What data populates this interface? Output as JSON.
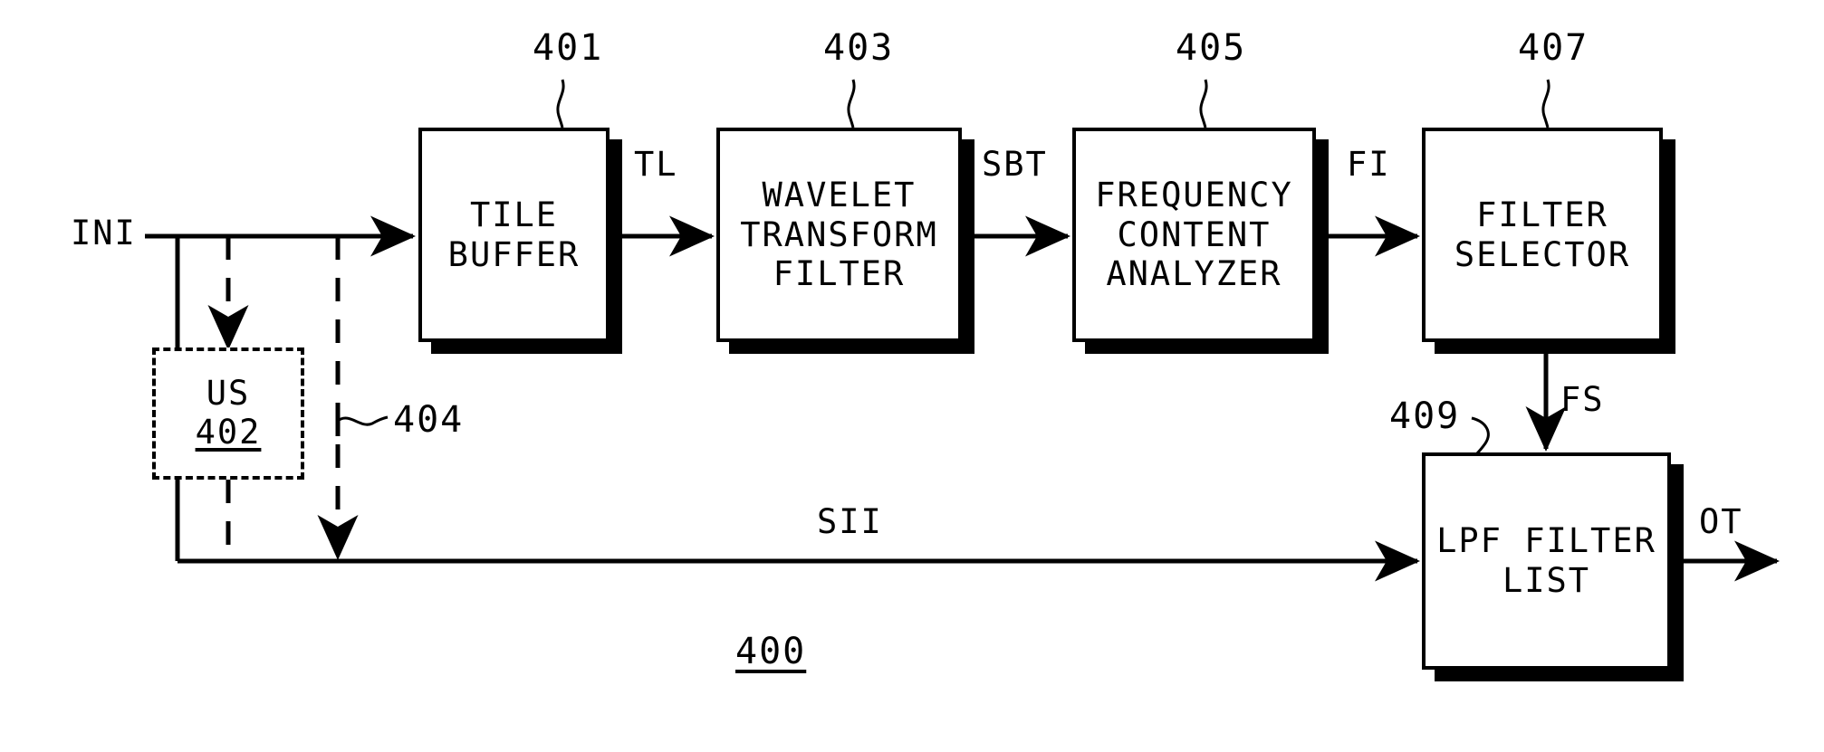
{
  "figure": {
    "number": "400",
    "kind": "patent-block-diagram",
    "title_visible": false
  },
  "blocks": [
    {
      "id": "tile-buffer",
      "label": "TILE\nBUFFER",
      "ref": "401",
      "style": "solid"
    },
    {
      "id": "upsampler",
      "label": "US",
      "ref": "402",
      "style": "dashed"
    },
    {
      "id": "wavelet-transform-filter",
      "label": "WAVELET\nTRANSFORM\nFILTER",
      "ref": "403",
      "style": "solid"
    },
    {
      "id": "frequency-content-analyzer",
      "label": "FREQUENCY\nCONTENT\nANALYZER",
      "ref": "405",
      "style": "solid"
    },
    {
      "id": "filter-selector",
      "label": "FILTER\nSELECTOR",
      "ref": "407",
      "style": "solid"
    },
    {
      "id": "lpf-filter-list",
      "label": "LPF FILTER\nLIST",
      "ref": "409",
      "style": "solid"
    }
  ],
  "refs": {
    "r400": "400",
    "r401": "401",
    "r402": "402",
    "r403": "403",
    "r404": "404",
    "r405": "405",
    "r407": "407",
    "r409": "409"
  },
  "signals": {
    "ini": "INI",
    "tl": "TL",
    "sbt": "SBT",
    "fi": "FI",
    "fs": "FS",
    "sii": "SII",
    "ot": "OT"
  },
  "colors": {
    "stroke": "#000000",
    "fill": "#ffffff",
    "shadow": "#000000"
  }
}
